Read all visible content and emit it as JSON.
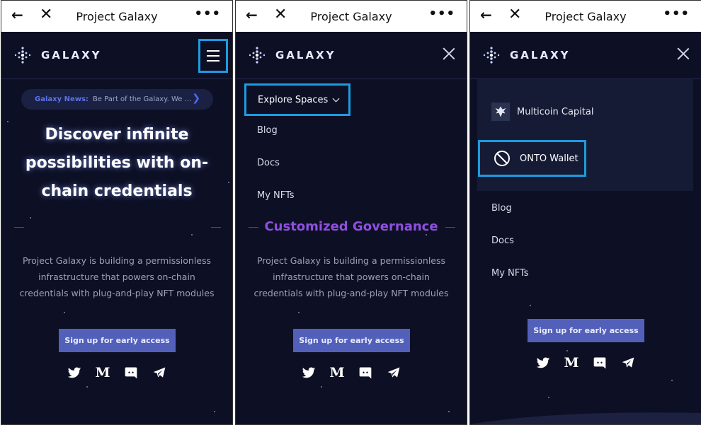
{
  "window": {
    "title": "Project Galaxy"
  },
  "brand": {
    "name": "GALAXY"
  },
  "news": {
    "label": "Galaxy News:",
    "text": "Be Part of the Galaxy. We ..."
  },
  "hero": {
    "line1": "Discover infinite",
    "line2": "possibilities with on-",
    "line3": "chain credentials"
  },
  "governance": "Customized Governance",
  "description": {
    "line1": "Project Galaxy is building a permissionless",
    "line2": "infrastructure that powers on-chain",
    "line3": "credentials with plug-and-play NFT modules"
  },
  "cta": {
    "signup_label": "Sign up for early access"
  },
  "menu": {
    "explore_label": "Explore Spaces",
    "blog": "Blog",
    "docs": "Docs",
    "my_nfts": "My NFTs"
  },
  "spaces": {
    "multicoin": "Multicoin Capital",
    "onto": "ONTO Wallet"
  },
  "icons": {
    "back": "back-arrow-icon",
    "close": "close-icon",
    "more": "more-icon",
    "menu": "hamburger-icon",
    "twitter": "twitter-icon",
    "medium": "medium-icon",
    "discord": "discord-icon",
    "telegram": "telegram-icon"
  },
  "colors": {
    "background": "#0d1025",
    "highlight": "#1e9bdf",
    "cta": "#5360b9",
    "governance": "#8f4fe0"
  }
}
